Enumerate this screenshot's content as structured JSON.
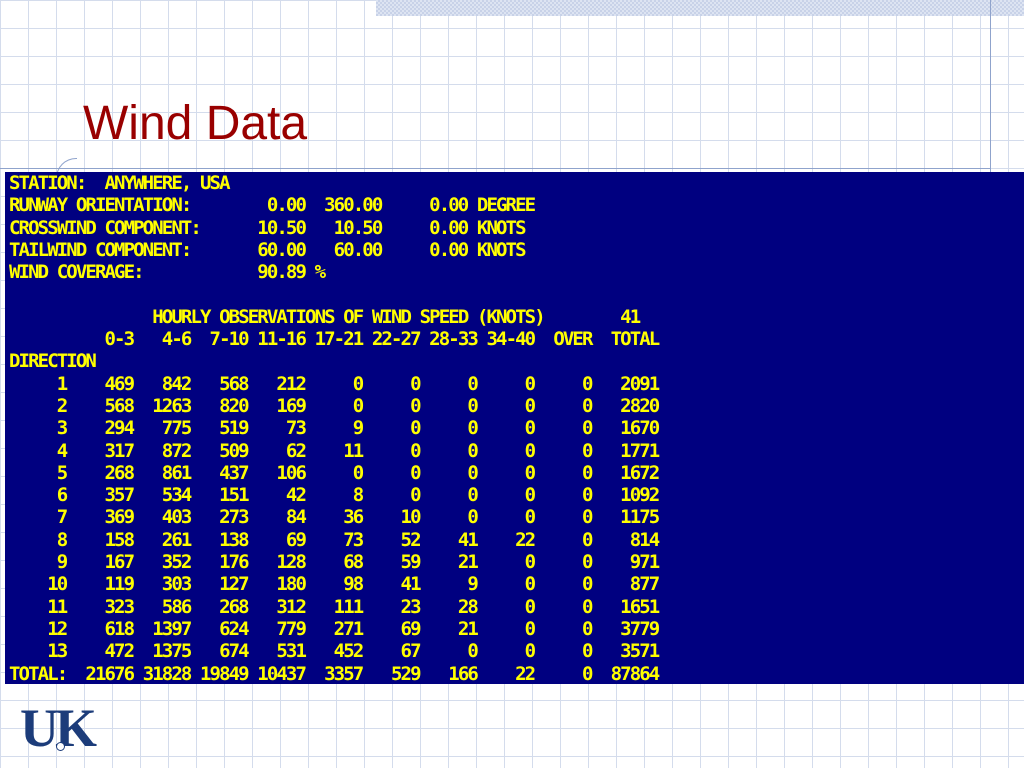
{
  "slide": {
    "title": "Wind Data",
    "logo_text": "UK"
  },
  "terminal": {
    "header_lines": [
      "STATION:  ANYWHERE, USA",
      "RUNWAY ORIENTATION:        0.00  360.00     0.00 DEGREE",
      "CROSSWIND COMPONENT:      10.50   10.50     0.00 KNOTS",
      "TAILWIND COMPONENT:       60.00   60.00     0.00 KNOTS",
      "WIND COVERAGE:            90.89 %"
    ],
    "table_title": "HOURLY OBSERVATIONS OF WIND SPEED (KNOTS)",
    "over_top": "41",
    "columns": [
      "0-3",
      "4-6",
      "7-10",
      "11-16",
      "17-21",
      "22-27",
      "28-33",
      "34-40",
      "OVER",
      "TOTAL"
    ],
    "row_header": "DIRECTION",
    "rows": [
      [
        "1",
        "469",
        "842",
        "568",
        "212",
        "0",
        "0",
        "0",
        "0",
        "0",
        "2091"
      ],
      [
        "2",
        "568",
        "1263",
        "820",
        "169",
        "0",
        "0",
        "0",
        "0",
        "0",
        "2820"
      ],
      [
        "3",
        "294",
        "775",
        "519",
        "73",
        "9",
        "0",
        "0",
        "0",
        "0",
        "1670"
      ],
      [
        "4",
        "317",
        "872",
        "509",
        "62",
        "11",
        "0",
        "0",
        "0",
        "0",
        "1771"
      ],
      [
        "5",
        "268",
        "861",
        "437",
        "106",
        "0",
        "0",
        "0",
        "0",
        "0",
        "1672"
      ],
      [
        "6",
        "357",
        "534",
        "151",
        "42",
        "8",
        "0",
        "0",
        "0",
        "0",
        "1092"
      ],
      [
        "7",
        "369",
        "403",
        "273",
        "84",
        "36",
        "10",
        "0",
        "0",
        "0",
        "1175"
      ],
      [
        "8",
        "158",
        "261",
        "138",
        "69",
        "73",
        "52",
        "41",
        "22",
        "0",
        "814"
      ],
      [
        "9",
        "167",
        "352",
        "176",
        "128",
        "68",
        "59",
        "21",
        "0",
        "0",
        "971"
      ],
      [
        "10",
        "119",
        "303",
        "127",
        "180",
        "98",
        "41",
        "9",
        "0",
        "0",
        "877"
      ],
      [
        "11",
        "323",
        "586",
        "268",
        "312",
        "111",
        "23",
        "28",
        "0",
        "0",
        "1651"
      ],
      [
        "12",
        "618",
        "1397",
        "624",
        "779",
        "271",
        "69",
        "21",
        "0",
        "0",
        "3779"
      ],
      [
        "13",
        "472",
        "1375",
        "674",
        "531",
        "452",
        "67",
        "0",
        "0",
        "0",
        "3571"
      ]
    ],
    "total_label": "TOTAL:",
    "totals": [
      "21676",
      "31828",
      "19849",
      "10437",
      "3357",
      "529",
      "166",
      "22",
      "0",
      "87864"
    ]
  },
  "colors": {
    "title": "#990000",
    "terminal_bg": "#000080",
    "terminal_text": "#ffff00",
    "logo": "#1c3c7a"
  }
}
